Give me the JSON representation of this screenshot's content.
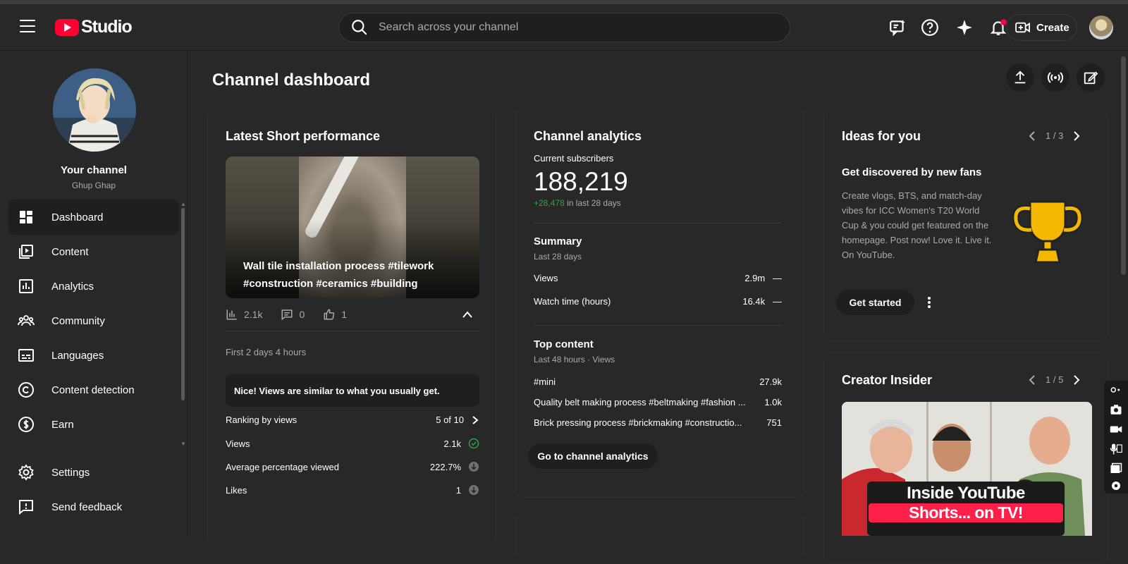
{
  "app": {
    "logo_text": "Studio",
    "brand_color": "#ff0033"
  },
  "search": {
    "placeholder": "Search across your channel"
  },
  "topbar": {
    "create_label": "Create"
  },
  "channel": {
    "title": "Your channel",
    "handle": "Ghup Ghap"
  },
  "nav": {
    "items": [
      {
        "label": "Dashboard",
        "icon": "dashboard-icon",
        "active": true
      },
      {
        "label": "Content",
        "icon": "content-icon"
      },
      {
        "label": "Analytics",
        "icon": "analytics-icon"
      },
      {
        "label": "Community",
        "icon": "community-icon"
      },
      {
        "label": "Languages",
        "icon": "languages-icon"
      },
      {
        "label": "Content detection",
        "icon": "copyright-icon"
      },
      {
        "label": "Earn",
        "icon": "dollar-icon"
      }
    ],
    "settings": "Settings",
    "feedback": "Send feedback"
  },
  "page": {
    "title": "Channel dashboard"
  },
  "latest_short": {
    "title": "Latest Short performance",
    "caption": "Wall tile installation process #tilework #construction #ceramics #building",
    "views": "2.1k",
    "comments": "0",
    "likes": "1",
    "period": "First 2 days 4 hours",
    "banner": "Nice! Views are similar to what you usually get.",
    "rows": [
      {
        "label": "Ranking by views",
        "value": "5 of 10"
      },
      {
        "label": "Views",
        "value": "2.1k"
      },
      {
        "label": "Average percentage viewed",
        "value": "222.7%"
      },
      {
        "label": "Likes",
        "value": "1"
      }
    ]
  },
  "analytics": {
    "title": "Channel analytics",
    "subs_label": "Current subscribers",
    "subs_value": "188,219",
    "subs_delta": "+28,478",
    "subs_delta_suffix": "in last 28 days",
    "summary_title": "Summary",
    "summary_period": "Last 28 days",
    "summary_rows": [
      {
        "label": "Views",
        "value": "2.9m",
        "trend": "—"
      },
      {
        "label": "Watch time (hours)",
        "value": "16.4k",
        "trend": "—"
      }
    ],
    "top_title": "Top content",
    "top_period": "Last 48 hours · Views",
    "top_rows": [
      {
        "label": "#mini",
        "value": "27.9k"
      },
      {
        "label": "Quality belt making process #beltmaking #fashion ...",
        "value": "1.0k"
      },
      {
        "label": "Brick pressing process #brickmaking #constructio...",
        "value": "751"
      }
    ],
    "button": "Go to channel analytics"
  },
  "ideas": {
    "title": "Ideas for you",
    "pager": "1 / 3",
    "subtitle": "Get discovered by new fans",
    "text": "Create vlogs, BTS, and match-day vibes for ICC Women's T20 World Cup & you could get featured on the homepage. Post now! Love it. Live it. On YouTube.",
    "button": "Get started",
    "trophy_color": "#f5b800"
  },
  "insider": {
    "title": "Creator Insider",
    "pager": "1 / 5",
    "thumb_line1": "Inside YouTube",
    "thumb_line2": "Shorts... on TV!"
  }
}
